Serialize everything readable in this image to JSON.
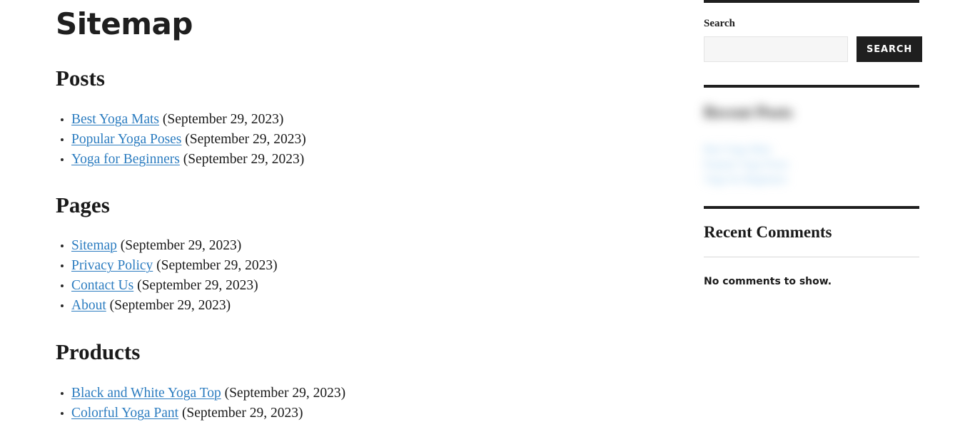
{
  "page": {
    "title": "Sitemap"
  },
  "main": {
    "sections": [
      {
        "heading": "Posts",
        "entries": [
          {
            "label": "Best Yoga Mats",
            "date": "(September 29, 2023)"
          },
          {
            "label": "Popular Yoga Poses",
            "date": "(September 29, 2023)"
          },
          {
            "label": "Yoga for Beginners",
            "date": "(September 29, 2023)"
          }
        ]
      },
      {
        "heading": "Pages",
        "entries": [
          {
            "label": "Sitemap",
            "date": "(September 29, 2023)"
          },
          {
            "label": "Privacy Policy",
            "date": "(September 29, 2023)"
          },
          {
            "label": "Contact Us",
            "date": "(September 29, 2023)"
          },
          {
            "label": "About",
            "date": "(September 29, 2023)"
          }
        ]
      },
      {
        "heading": "Products",
        "entries": [
          {
            "label": "Black and White Yoga Top",
            "date": "(September 29, 2023)"
          },
          {
            "label": "Colorful Yoga Pant",
            "date": "(September 29, 2023)"
          }
        ]
      }
    ]
  },
  "sidebar": {
    "search": {
      "label": "Search",
      "value": "",
      "placeholder": "",
      "button_label": "SEARCH"
    },
    "recent_posts": {
      "heading": "Recent Posts",
      "items": [
        {
          "label": "Best Yoga Mats"
        },
        {
          "label": "Popular Yoga Poses"
        },
        {
          "label": "Yoga for Beginners"
        }
      ]
    },
    "recent_comments": {
      "heading": "Recent Comments",
      "empty_text": "No comments to show."
    }
  },
  "colors": {
    "link": "#2b7cc0",
    "text": "#1a1a1a",
    "rule": "#1f1f1f",
    "button_bg": "#1f1f1f",
    "input_bg": "#f6f6f6"
  }
}
